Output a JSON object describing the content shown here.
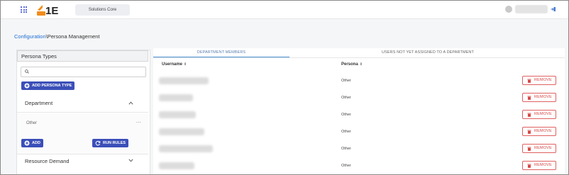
{
  "header": {
    "product_tab": "Solutions Core",
    "colors": {
      "brand_orange": "#f28c1b",
      "accent_blue": "#3b4fb8"
    }
  },
  "breadcrumb": {
    "link": "Configuration",
    "separator": "\\",
    "current": "Persona Management"
  },
  "left_panel": {
    "title": "Persona Types",
    "search": {
      "placeholder": "",
      "value": ""
    },
    "add_persona_type_label": "ADD PERSONA TYPE",
    "sections": [
      {
        "label": "Department",
        "expanded": true,
        "items": [
          {
            "label": "Other",
            "menu": "..."
          }
        ]
      },
      {
        "label": "Resource Demand",
        "expanded": false
      }
    ],
    "add_label": "ADD",
    "run_rules_label": "RUN RULES"
  },
  "right_panel": {
    "tabs": [
      {
        "label": "DEPARTMENT MEMBERS",
        "active": true
      },
      {
        "label": "USERS NOT YET ASSIGNED TO A DEPARTMENT",
        "active": false
      }
    ],
    "columns": [
      {
        "label": "Username",
        "sort": "⇕"
      },
      {
        "label": "Persona",
        "sort": "⇕"
      }
    ],
    "rows": [
      {
        "persona": "Other",
        "action": "REMOVE"
      },
      {
        "persona": "Other",
        "action": "REMOVE"
      },
      {
        "persona": "Other",
        "action": "REMOVE"
      },
      {
        "persona": "Other",
        "action": "REMOVE"
      },
      {
        "persona": "Other",
        "action": "REMOVE"
      },
      {
        "persona": "Other",
        "action": "REMOVE"
      }
    ]
  }
}
